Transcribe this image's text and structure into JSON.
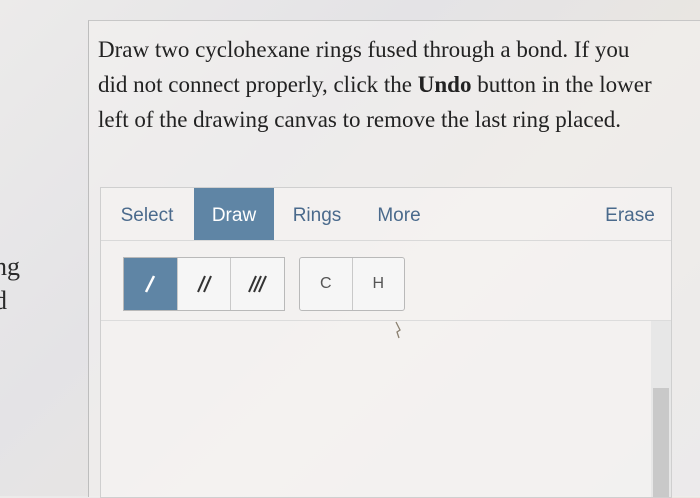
{
  "left_fragment": {
    "line1": "ng",
    "line2": "d"
  },
  "question": {
    "text_before": "Draw two cyclohexane rings fused through a bond. If you did not connect properly, click the ",
    "bold": "Undo",
    "text_after": " button in the lower left of the drawing canvas to remove the last ring placed."
  },
  "tabs": {
    "select": "Select",
    "draw": "Draw",
    "rings": "Rings",
    "more": "More",
    "erase": "Erase"
  },
  "active_tab": "Draw",
  "bonds": {
    "single": "single-bond-icon",
    "double": "double-bond-icon",
    "triple": "triple-bond-icon"
  },
  "atoms": {
    "carbon": "C",
    "hydrogen": "H"
  },
  "colors": {
    "accent": "#5f85a5",
    "tab_text": "#4a6a8c"
  }
}
